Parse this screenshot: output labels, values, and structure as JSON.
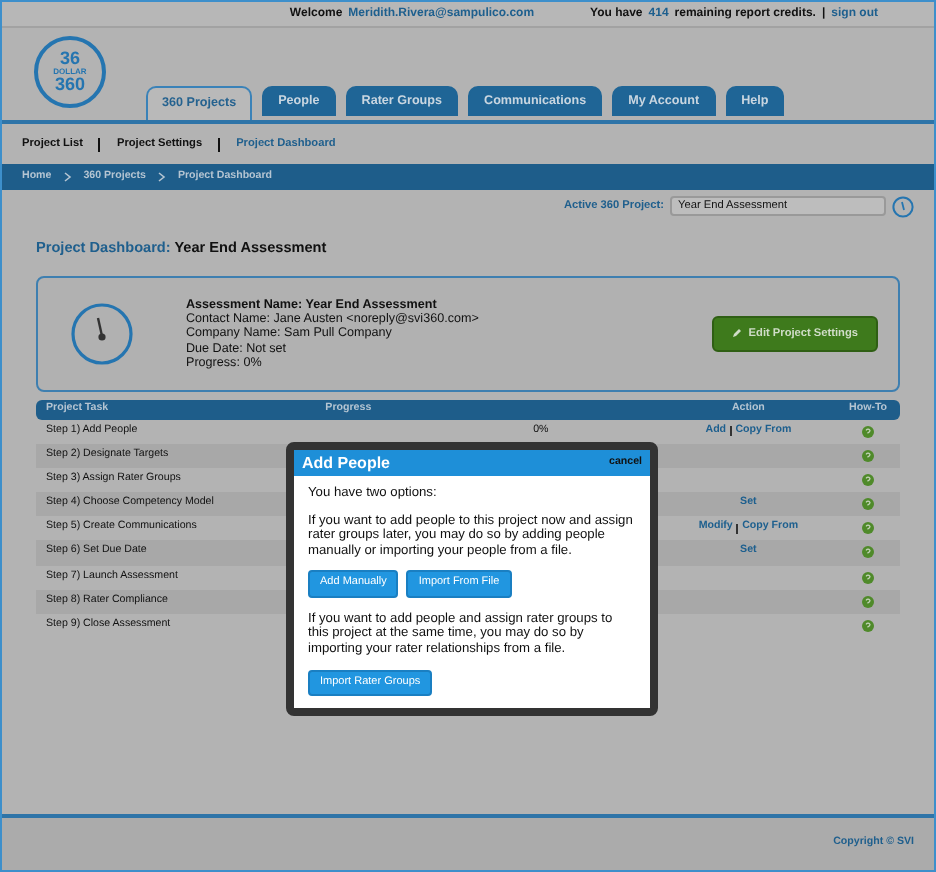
{
  "top_bar": {
    "welcome": "Welcome",
    "user_email": "Meridith.Rivera@sampulico.com",
    "credits_before": "You have",
    "credits": "414",
    "credits_after": "remaining report credits.",
    "separator": "|",
    "sign_out": "sign out"
  },
  "logo": {
    "lines": [
      "36",
      "DOLLAR",
      "360"
    ]
  },
  "tabs": [
    {
      "label": "360 Projects",
      "selected": true
    },
    {
      "label": "People",
      "selected": false
    },
    {
      "label": "Rater Groups",
      "selected": false
    },
    {
      "label": "Communications",
      "selected": false
    },
    {
      "label": "My Account",
      "selected": false
    },
    {
      "label": "Help",
      "selected": false
    }
  ],
  "subnav": [
    {
      "label": "Project List",
      "selected": false
    },
    {
      "label": "Project Settings",
      "selected": false
    },
    {
      "label": "Project Dashboard",
      "selected": true
    }
  ],
  "breadcrumb": [
    "Home",
    "360 Projects",
    "Project Dashboard"
  ],
  "active_project": {
    "label": "Active 360 Project:",
    "value": "Year End Assessment"
  },
  "page_title": {
    "prefix": "Project Dashboard:",
    "name": "Year End Assessment"
  },
  "summary": {
    "lines": [
      "**Assessment Name: Year End Assessment**",
      "Contact Name: Jane Austen <noreply@svi360.com>",
      "Company Name: Sam Pull Company",
      "Due Date: Not set",
      "Progress: 0%"
    ],
    "button": "Edit Project Settings"
  },
  "table": {
    "columns": [
      "Project Task",
      "Progress",
      "Action",
      "How-To"
    ],
    "rows": [
      {
        "task": "Step 1) Add People",
        "progress": "0%",
        "actions": [
          "Add",
          "Copy From"
        ]
      },
      {
        "task": "Step 2) Designate Targets",
        "actions": []
      },
      {
        "task": "Step 3) Assign Rater Groups",
        "actions": []
      },
      {
        "task": "Step 4) Choose Competency Model",
        "actions": [
          "Set"
        ]
      },
      {
        "task": "Step 5) Create Communications",
        "actions": [
          "Modify",
          "Copy From"
        ]
      },
      {
        "task": "Step 6) Set Due Date",
        "actions": [
          "Set"
        ]
      },
      {
        "task": "Step 7) Launch Assessment",
        "actions": []
      },
      {
        "task": "Step 8) Rater Compliance",
        "actions": []
      },
      {
        "task": "Step 9) Close Assessment",
        "actions": []
      }
    ]
  },
  "footer": {
    "copyright": "Copyright © SVI"
  },
  "modal": {
    "title": "Add People",
    "cancel": "cancel",
    "intro": "You have two options:",
    "text_1": "If you want to add people to this project now and assign rater groups later, you may do so by adding people manually or importing your people from a file.",
    "buttons_1": [
      "Add Manually",
      "Import From File"
    ],
    "text_2": "If you want to add people and assign rater groups to this project at the same time, you may do so by importing your rater relationships from a file.",
    "buttons_2": [
      "Import Rater Groups"
    ]
  }
}
